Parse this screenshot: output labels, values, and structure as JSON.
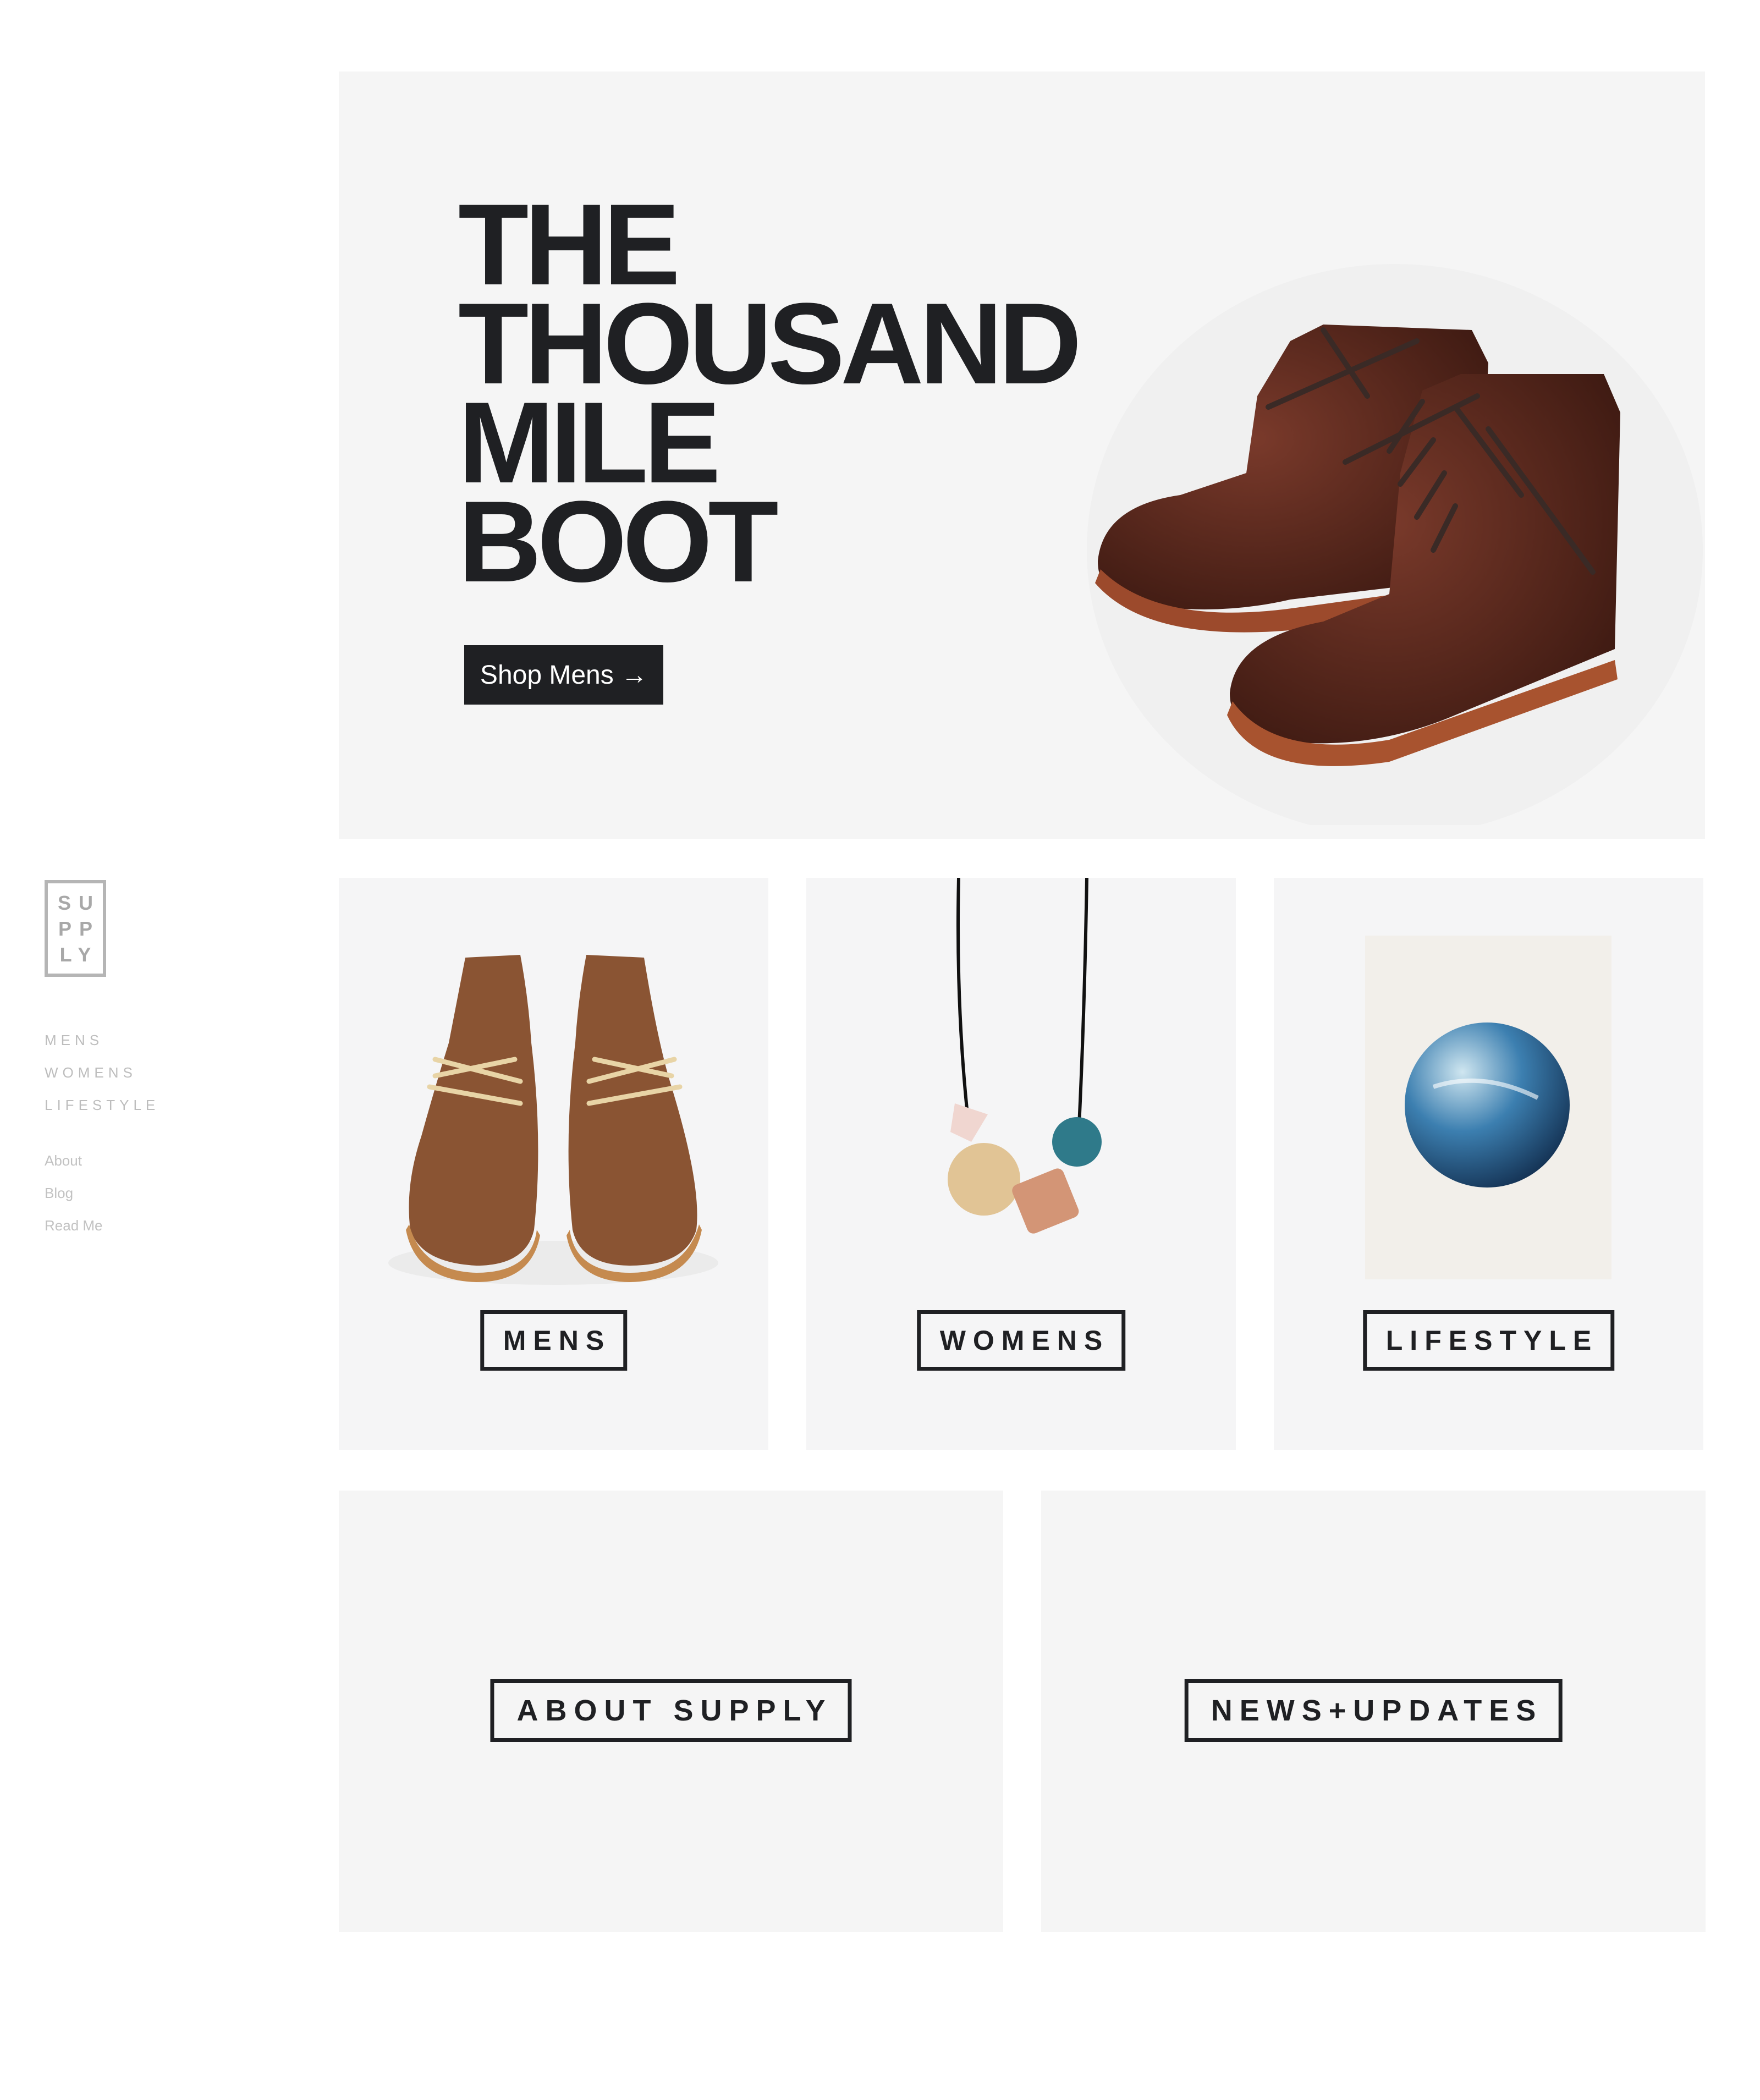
{
  "brand": {
    "logo_lines": [
      "SU",
      "PP",
      "LY"
    ]
  },
  "nav": {
    "primary": [
      "MENS",
      "WOMENS",
      "LIFESTYLE"
    ],
    "secondary": [
      "About",
      "Blog",
      "Read Me"
    ]
  },
  "hero": {
    "title_lines": [
      "THE",
      "THOUSAND",
      "MILE",
      "BOOT"
    ],
    "cta_label": "Shop Mens →",
    "image": "brown-leather-boots"
  },
  "categories": [
    {
      "label": "MENS",
      "image": "brown-chukka-shoes"
    },
    {
      "label": "WOMENS",
      "image": "bead-necklace"
    },
    {
      "label": "LIFESTYLE",
      "image": "blue-circle-print"
    }
  ],
  "blocks": [
    {
      "label": "ABOUT SUPPLY"
    },
    {
      "label": "NEWS+UPDATES"
    }
  ],
  "colors": {
    "ink": "#1f2023",
    "panel": "#f5f5f5",
    "nav_text": "#bdbdbd",
    "leather": "#5a2a1d"
  }
}
